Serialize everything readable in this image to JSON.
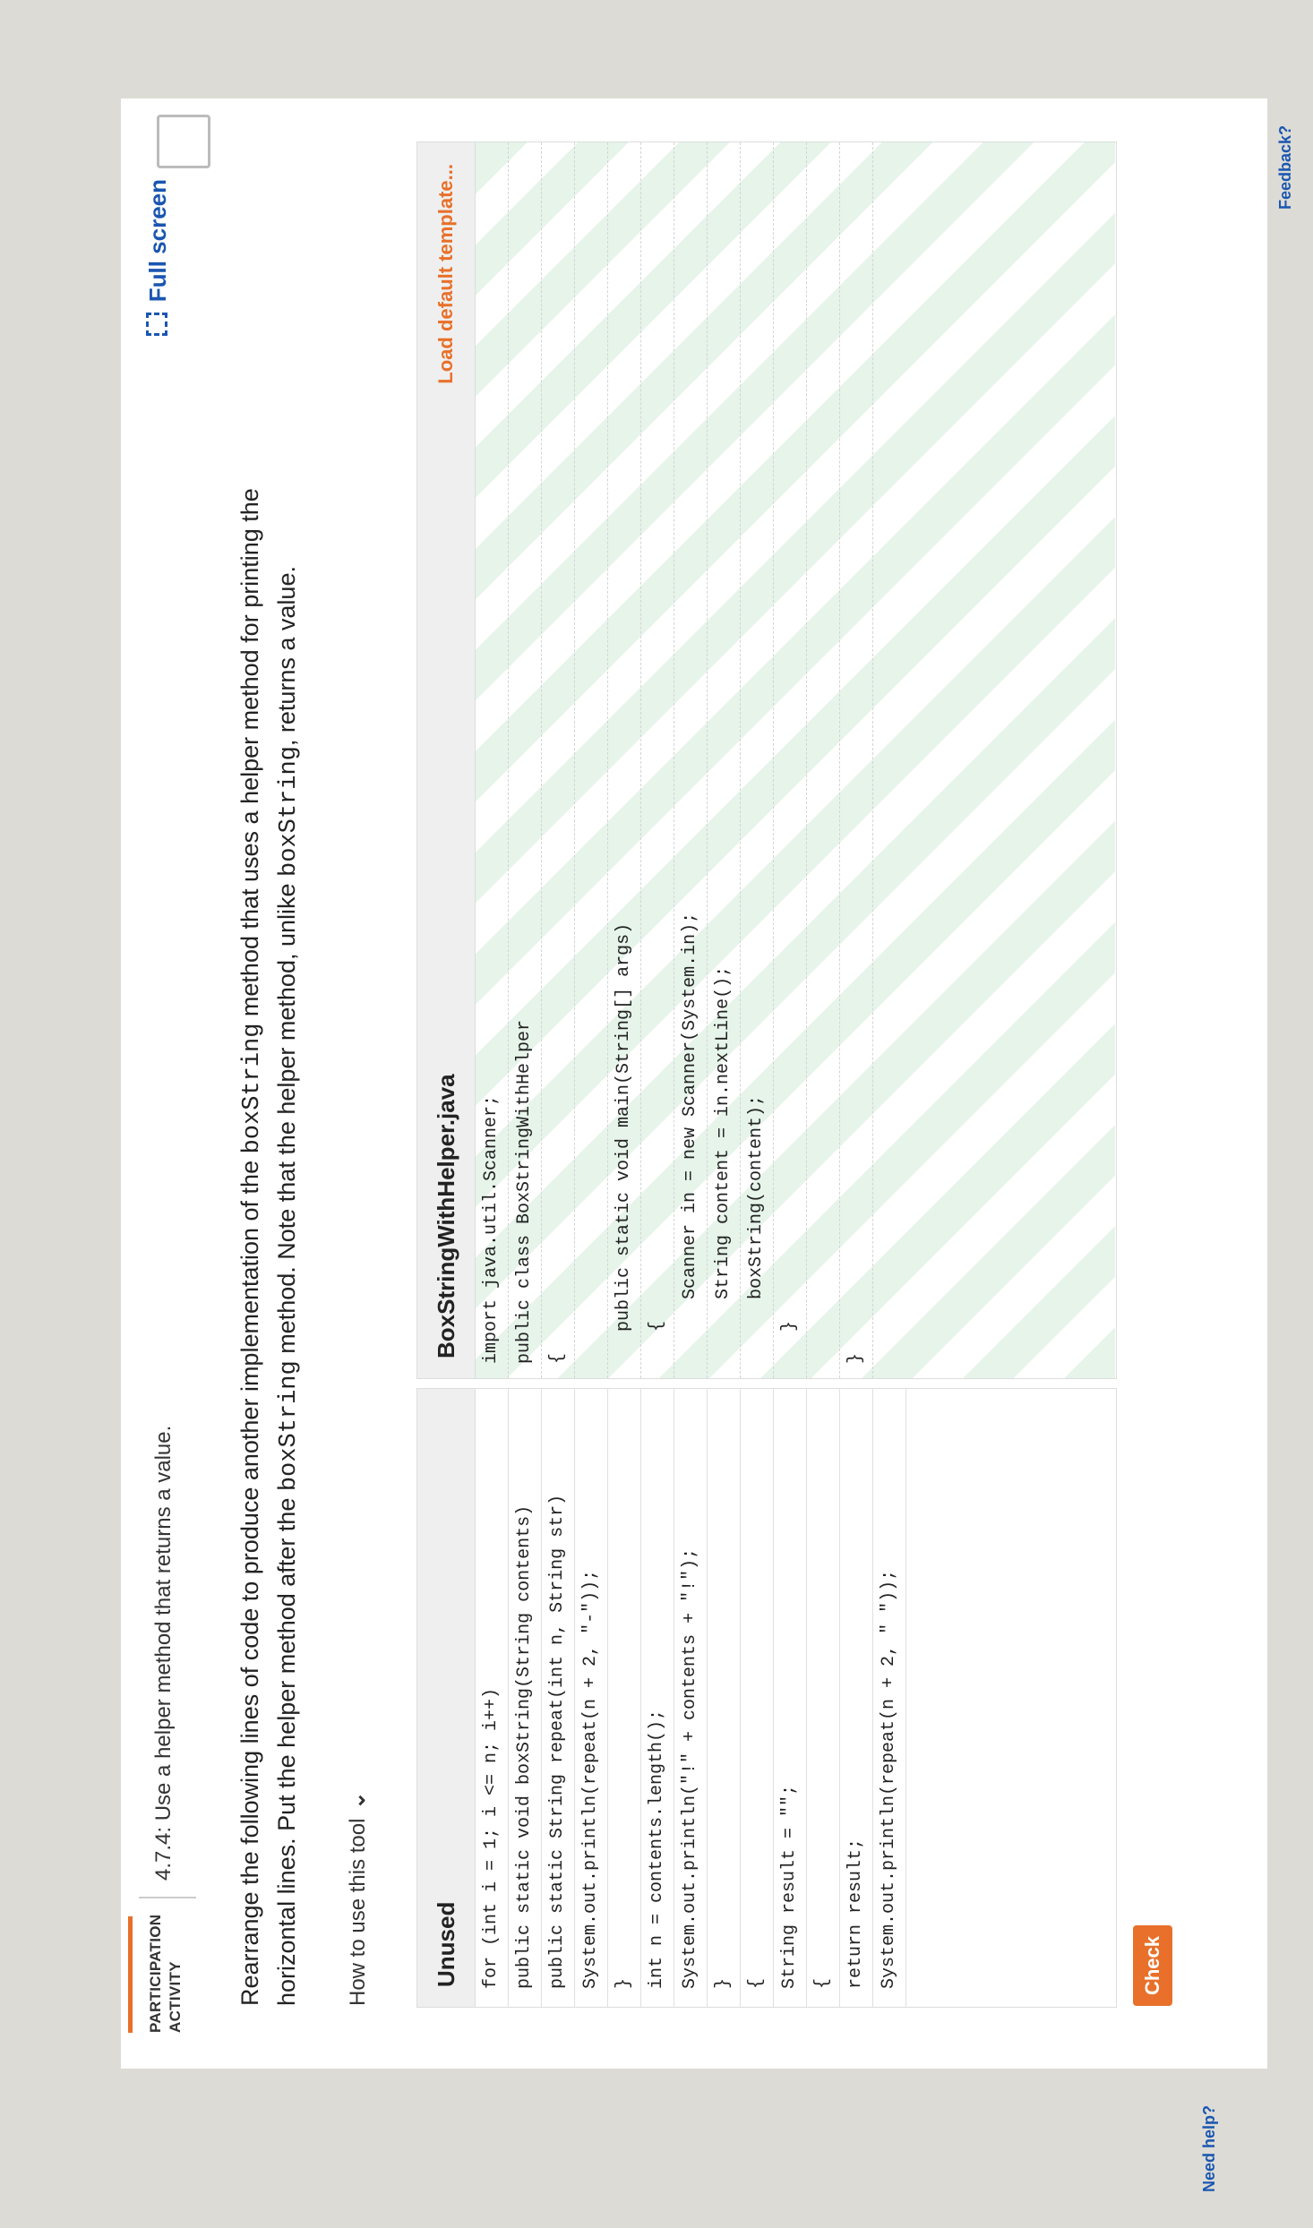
{
  "activity": {
    "type_label": "PARTICIPATION ACTIVITY",
    "title": "4.7.4: Use a helper method that returns a value.",
    "fullscreen_label": "Full screen"
  },
  "instructions": {
    "part1": "Rearrange the following lines of code to produce another implementation of the ",
    "code1": "boxString",
    "part2": " method that uses a helper method for printing the horizontal lines. Put the helper method after the ",
    "code2": "boxString",
    "part3": " method. Note that the helper method, unlike ",
    "code3": "boxString",
    "part4": ", returns a value."
  },
  "how_to_use": "How to use this tool",
  "unused_panel": {
    "title": "Unused",
    "lines": [
      "for (int i = 1; i <= n; i++)",
      "public static void boxString(String contents)",
      "public static String repeat(int n, String str)",
      "System.out.println(repeat(n + 2, \"-\"));",
      "}",
      "int n = contents.length();",
      "System.out.println(\"!\" + contents + \"!\");",
      "}",
      "{",
      "String result = \"\";",
      "{",
      "return result;",
      "System.out.println(repeat(n + 2, \" \"));"
    ]
  },
  "file_panel": {
    "title": "BoxStringWithHelper.java",
    "load_default": "Load default template...",
    "code": [
      "import java.util.Scanner;",
      "public class BoxStringWithHelper",
      "{",
      "",
      "   public static void main(String[] args)",
      "   {",
      "      Scanner in = new Scanner(System.in);",
      "      String content = in.nextLine();",
      "      boxString(content);",
      "   }",
      "",
      "}"
    ]
  },
  "check_label": "Check",
  "need_help": "Need help?",
  "feedback": "Feedback?"
}
